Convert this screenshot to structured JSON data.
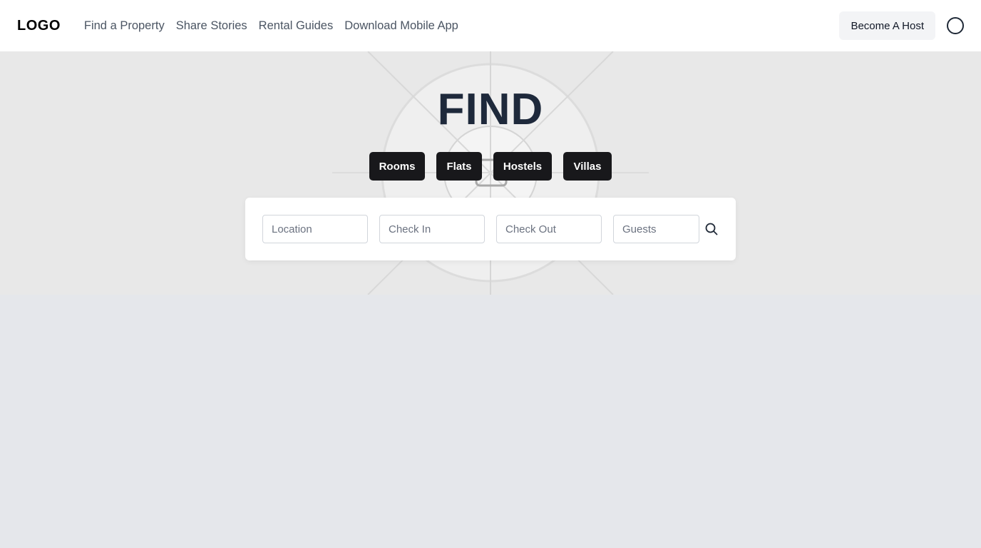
{
  "header": {
    "logo": "LOGO",
    "nav": [
      {
        "label": "Find a Property"
      },
      {
        "label": "Share Stories"
      },
      {
        "label": "Rental Guides"
      },
      {
        "label": "Download Mobile App"
      }
    ],
    "host_button": "Become A Host",
    "avatar_icon": "user-circle-icon"
  },
  "hero": {
    "title": "FIND",
    "categories": [
      "Rooms",
      "Flats",
      "Hostels",
      "Villas"
    ]
  },
  "search": {
    "location_placeholder": "Location",
    "checkin_placeholder": "Check In",
    "checkout_placeholder": "Check Out",
    "guests_placeholder": "Guests",
    "search_icon": "search-icon"
  },
  "colors": {
    "header_bg": "#ffffff",
    "hero_bg": "#e8e8e8",
    "page_bg": "#e5e7eb",
    "button_dark": "#18181b",
    "title": "#1e293b"
  }
}
